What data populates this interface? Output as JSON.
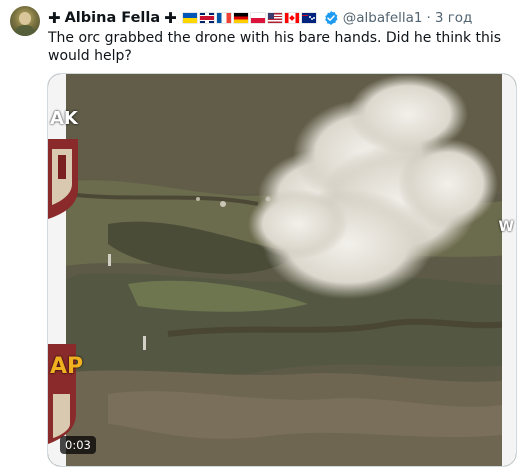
{
  "author": {
    "cross_prefix": "✚",
    "name": "Albina Fella",
    "cross_suffix": "✚",
    "flags": [
      "ua",
      "gb",
      "fr",
      "de",
      "pl",
      "us",
      "ca",
      "au"
    ],
    "verified_icon": "verified-badge-icon",
    "handle": "@albafella1",
    "separator": "·",
    "time": "3 год"
  },
  "tweet": {
    "text": "The orc grabbed the drone with his bare hands. Did he think this would help?"
  },
  "media": {
    "type": "video",
    "duration": "0:03",
    "overlay_text_top_left": "AK",
    "overlay_text_bottom_left": "AP",
    "overlay_text_right": "W"
  },
  "colors": {
    "text": "#0f1419",
    "muted": "#536471",
    "verified": "#1d9bf0",
    "border": "#cfd9de"
  }
}
